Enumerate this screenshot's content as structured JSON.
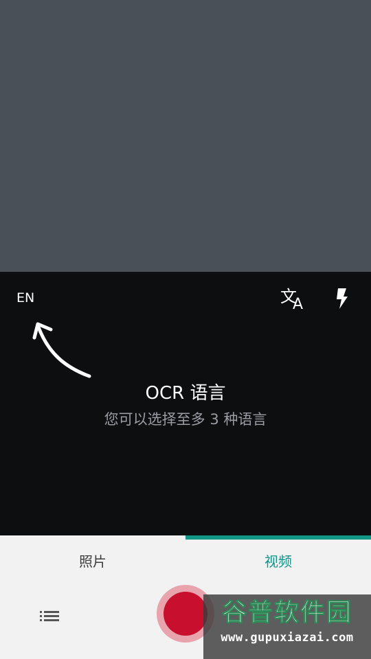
{
  "camera": {
    "language_code": "EN"
  },
  "hint": {
    "title": "OCR 语言",
    "subtitle": "您可以选择至多 3 种语言"
  },
  "tabs": [
    {
      "label": "照片",
      "active": false
    },
    {
      "label": "视频",
      "active": true
    }
  ],
  "icons": {
    "translate": "translate-icon",
    "flash": "flash-icon",
    "arrow": "curved-arrow-icon",
    "list": "list-icon",
    "record": "record-icon"
  },
  "colors": {
    "preview": "#4a5058",
    "overlay": "#0d0e10",
    "accent": "#119688",
    "record": "#c8102e",
    "record_ring": "#e8a3ad"
  },
  "watermark": {
    "name": "谷普软件园",
    "url": "www.gupuxiazai.com"
  }
}
